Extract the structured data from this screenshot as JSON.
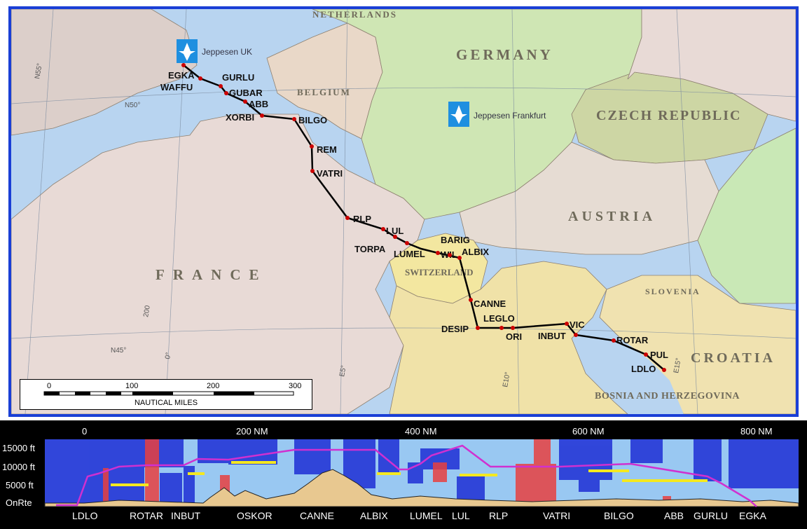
{
  "map": {
    "countries": [
      {
        "id": "netherlands",
        "name": "NETHERLANDS"
      },
      {
        "id": "germany",
        "name": "GERMANY"
      },
      {
        "id": "belgium",
        "name": "BELGIUM"
      },
      {
        "id": "czech",
        "name": "CZECH REPUBLIC"
      },
      {
        "id": "france",
        "name": "FRANCE"
      },
      {
        "id": "austria",
        "name": "AUSTRIA"
      },
      {
        "id": "switzerland",
        "name": "SWITZERLAND"
      },
      {
        "id": "slovenia",
        "name": "SLOVENIA"
      },
      {
        "id": "croatia",
        "name": "CROATIA"
      },
      {
        "id": "bosnia",
        "name": "BOSNIA AND HERZEGOVINA"
      }
    ],
    "offices": [
      {
        "id": "uk",
        "name": "Jeppesen UK"
      },
      {
        "id": "frankfurt",
        "name": "Jeppesen Frankfurt"
      }
    ],
    "grid_labels": {
      "n55": "N55°",
      "n50": "N50°",
      "n45": "N45°",
      "e0": "0°",
      "e5": "E5°",
      "e10": "E10°",
      "e15": "E15°",
      "r200": "200"
    },
    "waypoints": [
      "EGKA",
      "WAFFU",
      "GURLU",
      "GUBAR",
      "ABB",
      "XORBI",
      "BILGO",
      "REM",
      "VATRI",
      "RLP",
      "LUL",
      "TORPA",
      "LUMEL",
      "WIL",
      "BARIG",
      "ALBIX",
      "CANNE",
      "LEGLO",
      "DESIP",
      "ORI",
      "VIC",
      "INBUT",
      "ROTAR",
      "PUL",
      "LDLO"
    ],
    "scale": {
      "ticks": [
        "0",
        "100",
        "200",
        "300"
      ],
      "unit": "NAUTICAL MILES"
    }
  },
  "profile": {
    "distance_labels": [
      "0",
      "200 NM",
      "400 NM",
      "600 NM",
      "800 NM"
    ],
    "altitude_labels": [
      "15000 ft",
      "10000 ft",
      "5000 ft",
      "OnRte"
    ],
    "waypoint_labels": [
      "LDLO",
      "ROTAR",
      "INBUT",
      "OSKOR",
      "CANNE",
      "ALBIX",
      "LUMEL",
      "LUL",
      "RLP",
      "VATRI",
      "BILGO",
      "ABB",
      "GURLU",
      "EGKA"
    ]
  },
  "colors": {
    "route": "#000000",
    "waypoint": "#cc0000",
    "frame": "#1a3fd6",
    "sea": "#b8d4f0"
  }
}
